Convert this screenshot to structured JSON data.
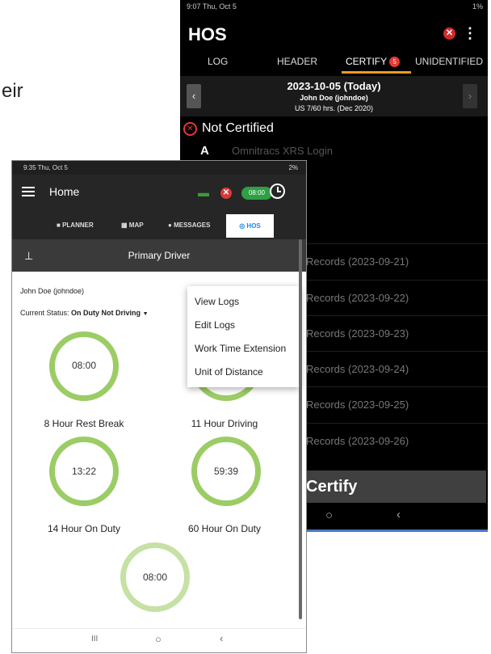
{
  "background_text": "eir",
  "back_phone": {
    "status_left": "9:07 Thu, Oct 5",
    "status_right": "1%",
    "title": "HOS",
    "more_icon": "⋮",
    "tabs": [
      {
        "label": "LOG"
      },
      {
        "label": "HEADER"
      },
      {
        "label": "CERTIFY",
        "badge": "5"
      },
      {
        "label": "UNIDENTIFIED"
      }
    ],
    "date": "2023-10-05 (Today)",
    "driver": "John Doe (johndoe)",
    "rule": "US 7/60 hrs. (Dec 2020)",
    "nav_prev": "‹",
    "nav_next": "›",
    "not_certified": "Not Certified",
    "a_letter": "A",
    "login_text": "Omnitracs XRS Login",
    "records": [
      "Records (2023-09-21)",
      "Records (2023-09-22)",
      "Records (2023-09-23)",
      "Records (2023-09-24)",
      "Records (2023-09-25)",
      "Records (2023-09-26)"
    ],
    "certify_button": "Certify",
    "nav_home": "○",
    "nav_back": "‹"
  },
  "front_phone": {
    "status_left": "9:35 Thu, Oct 5",
    "status_right": "2%",
    "app_title": "Home",
    "pill_time": "08:00",
    "tabs": [
      "PLANNER",
      "MAP",
      "MESSAGES",
      "HOS"
    ],
    "primary_driver": "Primary Driver",
    "driver_name": "John Doe (johndoe)",
    "status_label": "Current Status:",
    "status_value": "On Duty Not Driving",
    "menu": [
      "View Logs",
      "Edit Logs",
      "Work Time Extension",
      "Unit of Distance"
    ],
    "gauges": [
      {
        "value": "08:00",
        "label": "8 Hour Rest Break"
      },
      {
        "value": "",
        "label": "11 Hour Driving"
      },
      {
        "value": "13:22",
        "label": "14 Hour On Duty"
      },
      {
        "value": "59:39",
        "label": "60 Hour On Duty"
      },
      {
        "value": "08:00",
        "label": ""
      }
    ],
    "nav_recent": "III",
    "nav_home": "○",
    "nav_back": "‹"
  },
  "colors": {
    "gauge_green": "#9ccc65",
    "certify_underline": "#f39a1e",
    "error_red": "#e53935",
    "hos_tab_blue": "#1e88e5"
  }
}
